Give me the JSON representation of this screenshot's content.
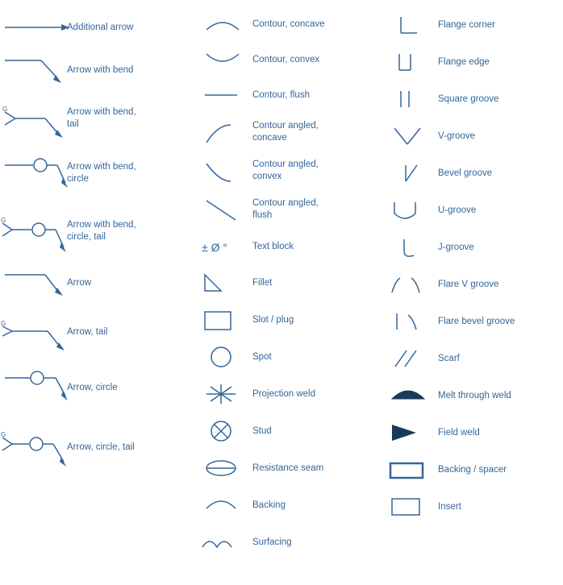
{
  "columns": [
    {
      "id": "left",
      "items": [
        {
          "id": "additional-arrow",
          "label": "Additional arrow"
        },
        {
          "id": "arrow-bend",
          "label": "Arrow with bend"
        },
        {
          "id": "arrow-bend-tail",
          "label": "Arrow with bend,\ntail"
        },
        {
          "id": "arrow-bend-circle",
          "label": "Arrow with bend,\ncircle"
        },
        {
          "id": "arrow-bend-circle-tail",
          "label": "Arrow with bend,\ncircle, tail"
        },
        {
          "id": "arrow",
          "label": "Arrow"
        },
        {
          "id": "arrow-tail",
          "label": "Arrow, tail"
        },
        {
          "id": "arrow-circle",
          "label": "Arrow, circle"
        },
        {
          "id": "arrow-circle-tail",
          "label": "Arrow, circle, tail"
        }
      ]
    },
    {
      "id": "mid",
      "items": [
        {
          "id": "contour-concave",
          "label": "Contour, concave"
        },
        {
          "id": "contour-convex",
          "label": "Contour, convex"
        },
        {
          "id": "contour-flush",
          "label": "Contour, flush"
        },
        {
          "id": "contour-angled-concave",
          "label": "Contour angled,\nconcave"
        },
        {
          "id": "contour-angled-convex",
          "label": "Contour angled,\nconvex"
        },
        {
          "id": "contour-angled-flush",
          "label": "Contour angled,\nflush"
        },
        {
          "id": "text-block",
          "label": "Text block"
        },
        {
          "id": "fillet",
          "label": "Fillet"
        },
        {
          "id": "slot-plug",
          "label": "Slot / plug"
        },
        {
          "id": "spot",
          "label": "Spot"
        },
        {
          "id": "projection-weld",
          "label": "Projection weld"
        },
        {
          "id": "stud",
          "label": "Stud"
        },
        {
          "id": "resistance-seam",
          "label": "Resistance seam"
        },
        {
          "id": "backing",
          "label": "Backing"
        },
        {
          "id": "surfacing",
          "label": "Surfacing"
        }
      ]
    },
    {
      "id": "right",
      "items": [
        {
          "id": "flange-corner",
          "label": "Flange corner"
        },
        {
          "id": "flange-edge",
          "label": "Flange edge"
        },
        {
          "id": "square-groove",
          "label": "Square groove"
        },
        {
          "id": "v-groove",
          "label": "V-groove"
        },
        {
          "id": "bevel-groove",
          "label": "Bevel groove"
        },
        {
          "id": "u-groove",
          "label": "U-groove"
        },
        {
          "id": "j-groove",
          "label": "J-groove"
        },
        {
          "id": "flare-v-groove",
          "label": "Flare V groove"
        },
        {
          "id": "flare-bevel-groove",
          "label": "Flare bevel groove"
        },
        {
          "id": "scarf",
          "label": "Scarf"
        },
        {
          "id": "melt-through-weld",
          "label": "Melt through weld"
        },
        {
          "id": "field-weld",
          "label": "Field weld"
        },
        {
          "id": "backing-spacer",
          "label": "Backing / spacer"
        },
        {
          "id": "insert",
          "label": "Insert"
        }
      ]
    }
  ]
}
